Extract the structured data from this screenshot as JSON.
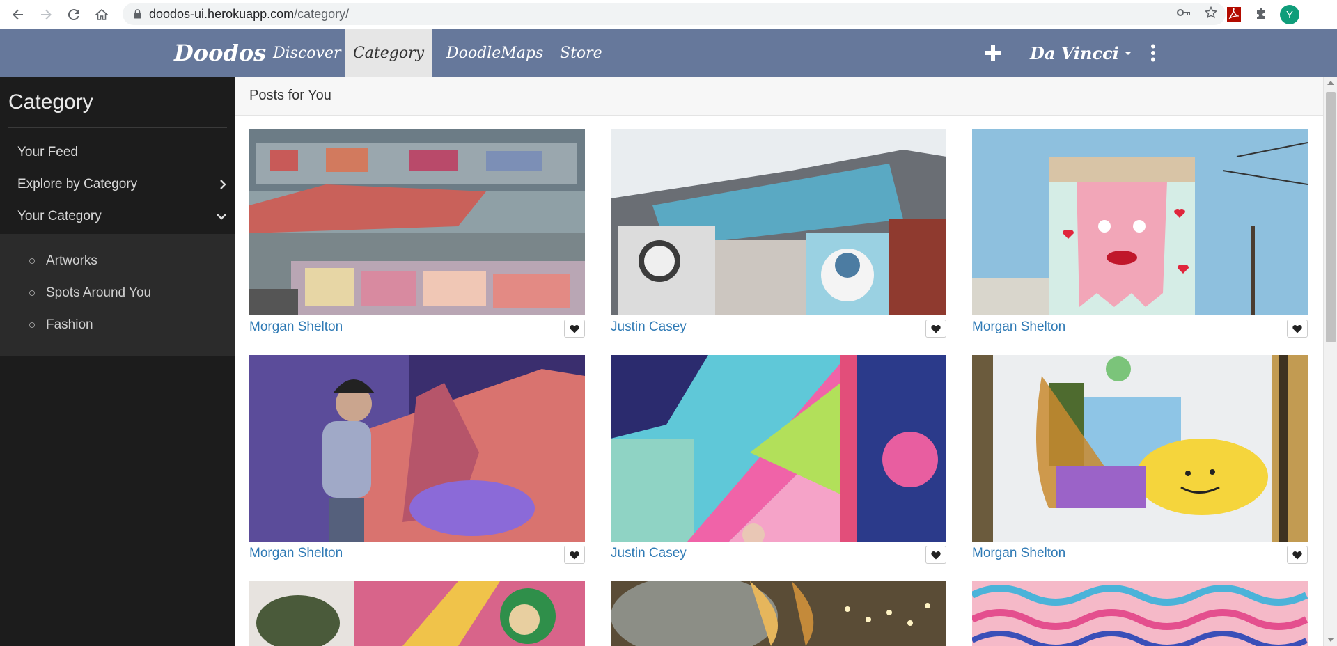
{
  "browser": {
    "url_host": "doodos-ui.herokuapp.com",
    "url_path": "/category/",
    "profile_initial": "Y"
  },
  "navbar": {
    "brand": "Doodos",
    "links": [
      "Discover",
      "Category",
      "DoodleMaps",
      "Store"
    ],
    "active_link": "Category",
    "user": "Da Vincci",
    "bg_color": "#66789b"
  },
  "sidebar": {
    "title": "Category",
    "items": [
      {
        "label": "Your Feed",
        "icon": ""
      },
      {
        "label": "Explore by Category",
        "icon": "chevron-right-icon"
      },
      {
        "label": "Your Category",
        "icon": "chevron-down-icon"
      }
    ],
    "subitems": [
      "Artworks",
      "Spots Around You",
      "Fashion"
    ]
  },
  "main": {
    "title": "Posts for You",
    "posts": [
      {
        "author": "Morgan Shelton",
        "image": "graffiti-train-yard"
      },
      {
        "author": "Justin Casey",
        "image": "street-mural-building"
      },
      {
        "author": "Morgan Shelton",
        "image": "bread-mural-wall"
      },
      {
        "author": "Morgan Shelton",
        "image": "artist-painting-canvas"
      },
      {
        "author": "Justin Casey",
        "image": "geometric-colorful-mural"
      },
      {
        "author": "Morgan Shelton",
        "image": "smiley-abstract-mural"
      },
      {
        "author": "",
        "image": "green-mask-mural"
      },
      {
        "author": "",
        "image": "golden-lights-mural"
      },
      {
        "author": "",
        "image": "pink-pattern-mural"
      }
    ]
  }
}
